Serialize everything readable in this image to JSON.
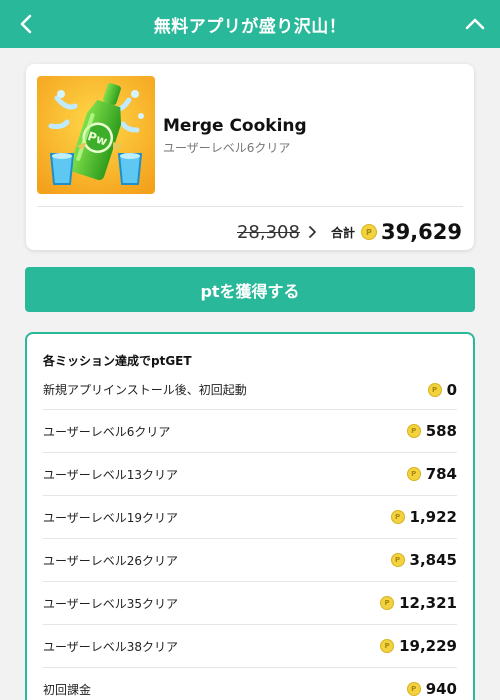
{
  "header": {
    "title": "無料アプリが盛り沢山！",
    "back_icon": "chevron-left-icon",
    "collapse_icon": "chevron-up-icon"
  },
  "app": {
    "name": "Merge Cooking",
    "condition": "ユーザーレベル6クリア",
    "icon": "app-icon-green-bottle",
    "old_points": "28,308",
    "total_label": "合計",
    "total_points": "39,629",
    "coin_glyph": "P"
  },
  "action": {
    "get_label": "ptを獲得する"
  },
  "missions": {
    "title": "各ミッション達成でptGET",
    "items": [
      {
        "label": "新規アプリインストール後、初回起動",
        "points": "0"
      },
      {
        "label": "ユーザーレベル6クリア",
        "points": "588"
      },
      {
        "label": "ユーザーレベル13クリア",
        "points": "784"
      },
      {
        "label": "ユーザーレベル19クリア",
        "points": "1,922"
      },
      {
        "label": "ユーザーレベル26クリア",
        "points": "3,845"
      },
      {
        "label": "ユーザーレベル35クリア",
        "points": "12,321"
      },
      {
        "label": "ユーザーレベル38クリア",
        "points": "19,229"
      },
      {
        "label": "初回課金",
        "points": "940"
      }
    ]
  },
  "colors": {
    "accent": "#2ab89a",
    "coin": "#f3d23f",
    "background": "#f2f2f2"
  }
}
